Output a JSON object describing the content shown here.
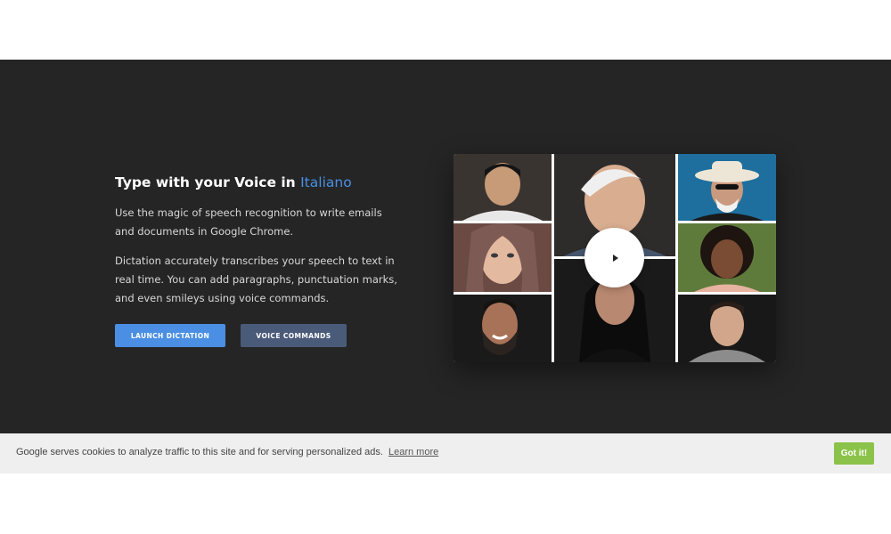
{
  "hero": {
    "title_prefix": "Type with your Voice in",
    "title_language": "Italiano",
    "paragraph_1": "Use the magic of speech recognition to write emails and documents in Google Chrome.",
    "paragraph_2": "Dictation accurately transcribes your speech to text in real time. You can add paragraphs, punctuation marks, and even smileys using voice commands.",
    "launch_label": "LAUNCH DICTATION",
    "commands_label": "VOICE COMMANDS"
  },
  "video": {
    "play_icon": "play-icon",
    "tile_colors": [
      "#3a3430",
      "#2e2b2b",
      "#1e6f9e",
      "#6b4a44",
      "#1b1a1a",
      "#5f7b3c",
      "#1a1a1a",
      "#181818"
    ]
  },
  "cookie": {
    "message": "Google serves cookies to analyze traffic to this site and for serving personalized ads.",
    "learn_more": "Learn more",
    "got_it": "Got it!"
  },
  "colors": {
    "accent": "#4a90e2",
    "secondary_button": "#4a5a79",
    "cookie_button": "#8bc34a",
    "hero_background": "#252526"
  }
}
